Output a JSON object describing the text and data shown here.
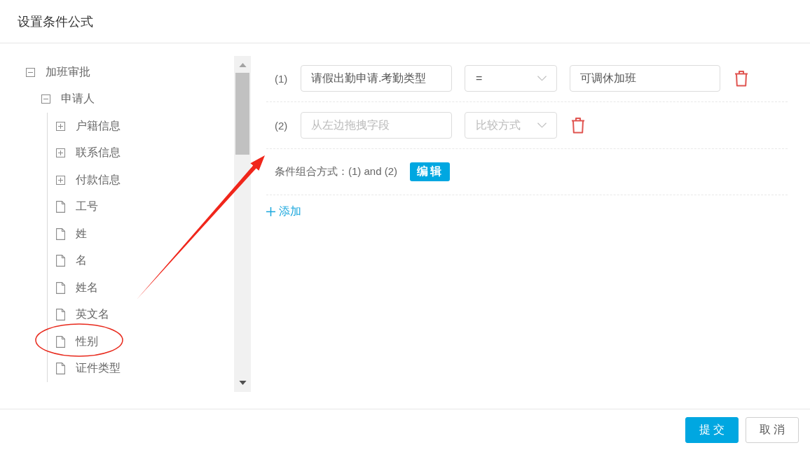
{
  "dialog": {
    "title": "设置条件公式"
  },
  "tree": [
    {
      "kind": "group",
      "label": "加班审批",
      "expanded": true,
      "children": [
        {
          "kind": "group",
          "label": "申请人",
          "expanded": true,
          "children": [
            {
              "kind": "group",
              "label": "户籍信息",
              "expanded": false
            },
            {
              "kind": "group",
              "label": "联系信息",
              "expanded": false
            },
            {
              "kind": "group",
              "label": "付款信息",
              "expanded": false
            },
            {
              "kind": "field",
              "label": "工号"
            },
            {
              "kind": "field",
              "label": "姓"
            },
            {
              "kind": "field",
              "label": "名"
            },
            {
              "kind": "field",
              "label": "姓名"
            },
            {
              "kind": "field",
              "label": "英文名"
            },
            {
              "kind": "field",
              "label": "性别"
            },
            {
              "kind": "field",
              "label": "证件类型"
            }
          ]
        }
      ]
    }
  ],
  "conditions": [
    {
      "index": "(1)",
      "field": {
        "value": "请假出勤申请.考勤类型"
      },
      "operator": {
        "value": "="
      },
      "compare_value": {
        "value": "可调休加班"
      }
    },
    {
      "index": "(2)",
      "field": {
        "placeholder": "从左边拖拽字段"
      },
      "operator": {
        "placeholder": "比较方式"
      }
    }
  ],
  "combination": {
    "label": "条件组合方式：(1) and (2)",
    "edit_button": "编辑"
  },
  "add_link": "添加",
  "footer": {
    "buttons": [
      {
        "label": "提交",
        "kind": "primary"
      },
      {
        "label": "取消",
        "kind": "default"
      }
    ]
  }
}
